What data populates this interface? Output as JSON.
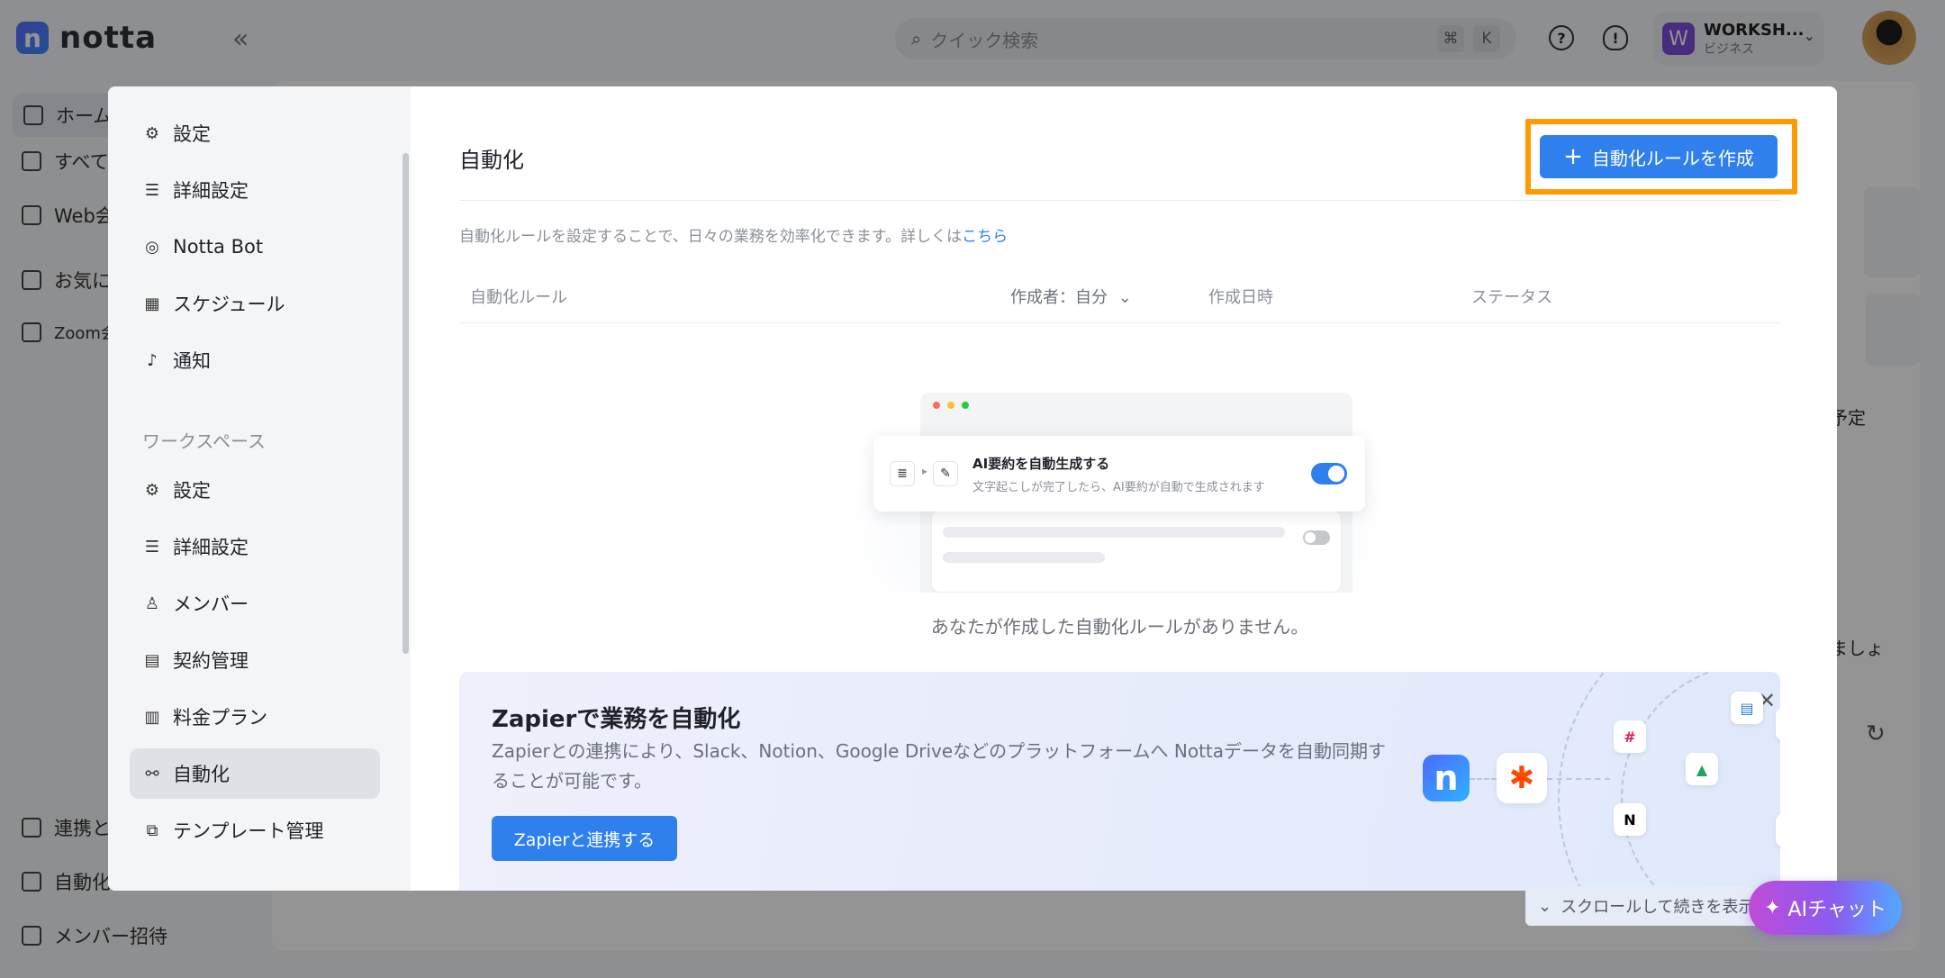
{
  "app": {
    "logo_text": "notta",
    "logo_mark": "n",
    "collapse_icon": "«",
    "search_placeholder": "クイック検索",
    "search_keys": [
      "⌘",
      "K"
    ],
    "workspace": {
      "initial": "W",
      "name": "WORKSH...",
      "role": "ビジネス"
    }
  },
  "bg_sidebar": {
    "items": [
      "ホーム",
      "すべて",
      "Web会",
      "お気に",
      "Zoom会"
    ],
    "bottom_items": [
      "連携と",
      "自動化",
      "メンバー招待"
    ]
  },
  "bg_main": {
    "fragments": [
      "予定",
      "ましょ"
    ]
  },
  "modal": {
    "personal_items": [
      {
        "label": "設定",
        "icon": "gear-icon"
      },
      {
        "label": "詳細設定",
        "icon": "sliders-icon"
      },
      {
        "label": "Notta Bot",
        "icon": "bot-icon"
      },
      {
        "label": "スケジュール",
        "icon": "calendar-icon"
      },
      {
        "label": "通知",
        "icon": "bell-icon"
      }
    ],
    "workspace_section_label": "ワークスペース",
    "workspace_items": [
      {
        "label": "設定",
        "icon": "gear-icon"
      },
      {
        "label": "詳細設定",
        "icon": "sliders-icon"
      },
      {
        "label": "メンバー",
        "icon": "members-icon"
      },
      {
        "label": "契約管理",
        "icon": "contract-icon"
      },
      {
        "label": "料金プラン",
        "icon": "map-icon"
      },
      {
        "label": "自動化",
        "icon": "automation-icon",
        "active": true
      },
      {
        "label": "テンプレート管理",
        "icon": "template-icon"
      }
    ],
    "title": "自動化",
    "create_button": "自動化ルールを作成",
    "description": "自動化ルールを設定することで、日々の業務を効率化できます。詳しくは",
    "description_link": "こちら",
    "table_headers": {
      "rule": "自動化ルール",
      "creator": "作成者：自分",
      "created_at": "作成日時",
      "status": "ステータス"
    },
    "illustration": {
      "card_title": "AI要約を自動生成する",
      "card_subtitle": "文字起こしが完了したら、AI要約が自動で生成されます"
    },
    "empty_text": "あなたが作成した自動化ルールがありません。",
    "zapier": {
      "title": "Zapierで業務を自動化",
      "description": "Zapierとの連携により、Slack、Notion、Google Driveなどのプラットフォームへ Nottaデータを自動同期することが可能です。",
      "button": "Zapierと連携する"
    }
  },
  "scroll_hint": "スクロールして続きを表示",
  "ai_chat": "AIチャット",
  "colors": {
    "accent": "#2f80ed",
    "highlight": "#ff9a00"
  }
}
